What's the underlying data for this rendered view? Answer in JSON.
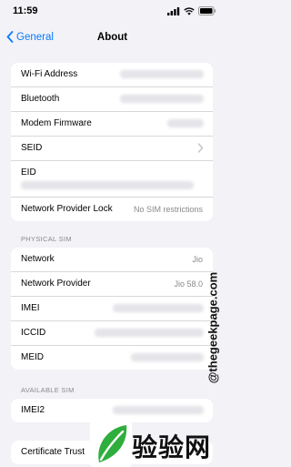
{
  "status": {
    "time": "11:59"
  },
  "nav": {
    "back": "General",
    "title": "About"
  },
  "group1": {
    "wifi": "Wi-Fi Address",
    "bluetooth": "Bluetooth",
    "modem": "Modem Firmware",
    "seid": "SEID",
    "eid": "EID",
    "lock": "Network Provider Lock",
    "lock_value": "No SIM restrictions"
  },
  "physical": {
    "header": "PHYSICAL SIM",
    "network": "Network",
    "network_value": "Jio",
    "provider": "Network Provider",
    "provider_value": "Jio 58.0",
    "imei": "IMEI",
    "iccid": "ICCID",
    "meid": "MEID"
  },
  "available": {
    "header": "AVAILABLE SIM",
    "imei2": "IMEI2"
  },
  "cert": {
    "label": "Certificate Trust"
  },
  "watermark": "@thegeekpage.com",
  "brand": "验验网",
  "colors": {
    "accent": "#0a7aff",
    "background": "#f2f2f7",
    "secondary_text": "#8a8a8e",
    "brand_green": "#2fae3e"
  }
}
